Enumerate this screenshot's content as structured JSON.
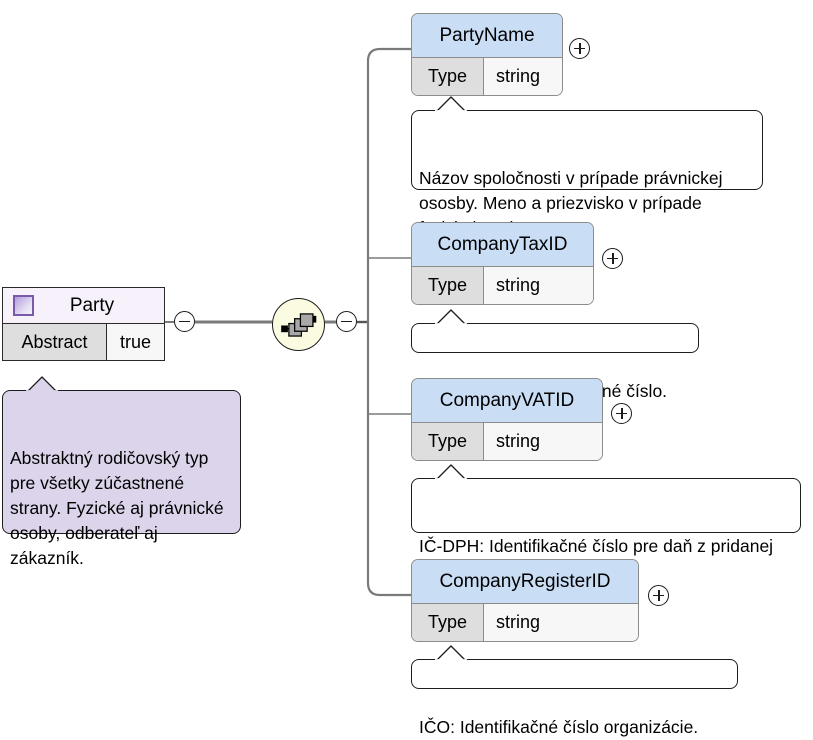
{
  "diagram": {
    "kind": "xml-schema-tree",
    "colors": {
      "element_header": "#c9ddf5",
      "type_label_cell": "#dedede",
      "type_value_cell": "#f7f7f7",
      "complextype_header": "#f6f1fb",
      "complextype_annotation": "#dcd4ea",
      "sequence_icon_fill": "#fbfbe2",
      "border": "#8c8c8c"
    },
    "root": {
      "name": "Party",
      "icon": "complextype-square-icon",
      "attribute_label": "Abstract",
      "attribute_value": "true",
      "collapse_control": "minus-circle",
      "annotation": "Abstraktný rodičovský typ pre všetky zúčastnené strany. Fyzické aj právnické osoby, odberateľ aj zákazník."
    },
    "compositor": {
      "kind": "sequence",
      "icon": "sequence-icon",
      "collapse_control": "minus-circle"
    },
    "children": [
      {
        "name": "PartyName",
        "type_label": "Type",
        "type_value": "string",
        "expand_control": "plus-circle",
        "annotation": "Názov spoločnosti v prípade právnickej ososby. Meno a priezvisko v prípade fyzickej osoby."
      },
      {
        "name": "CompanyTaxID",
        "type_label": "Type",
        "type_value": "string",
        "expand_control": "plus-circle",
        "annotation": "DIČ: Daňové identifikačné číslo."
      },
      {
        "name": "CompanyVATID",
        "type_label": "Type",
        "type_value": "string",
        "expand_control": "plus-circle",
        "annotation": "IČ-DPH: Identifikačné číslo pre daň z pridanej hodnoty."
      },
      {
        "name": "CompanyRegisterID",
        "type_label": "Type",
        "type_value": "string",
        "expand_control": "plus-circle",
        "annotation": "IČO: Identifikačné číslo organizácie."
      }
    ]
  }
}
